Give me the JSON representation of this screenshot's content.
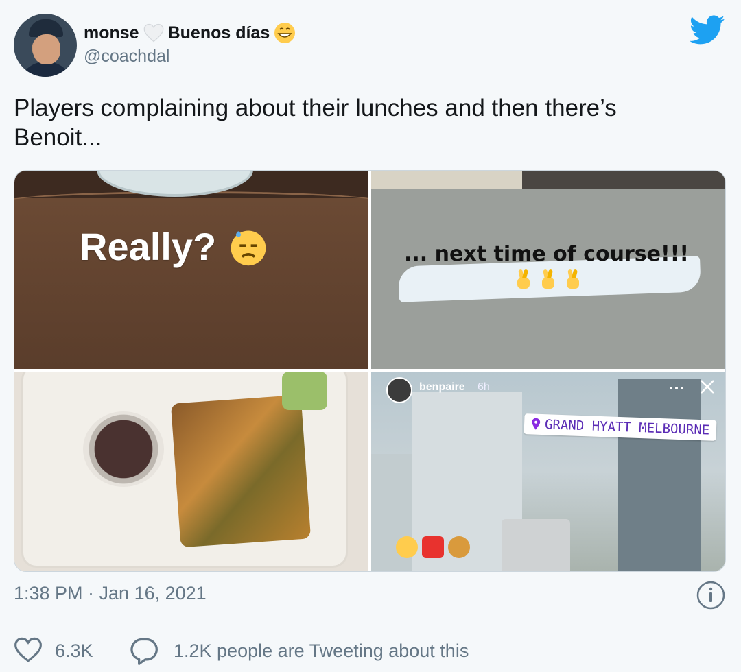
{
  "author": {
    "display_name": "monse",
    "display_name_suffix": "Buenos días",
    "handle": "@coachdal"
  },
  "tweet": {
    "text": "Players complaining about their lunches and then there’s Benoit..."
  },
  "media": {
    "tile1_caption": "Really?",
    "tile2_caption": "... next time of course!!!",
    "tile4_story_user": "benpaire",
    "tile4_story_time": "6h",
    "tile4_location": "GRAND HYATT MELBOURNE"
  },
  "meta": {
    "timestamp": "1:38 PM · Jan 16, 2021"
  },
  "actions": {
    "like_count": "6.3K",
    "reply_text": "1.2K people are Tweeting about this"
  },
  "icons": {
    "heart": "white-heart-icon",
    "grin": "grinning-face-icon",
    "bird": "twitter-bird-icon",
    "info": "info-icon",
    "like": "like-heart-icon",
    "reply": "reply-bubble-icon"
  },
  "colors": {
    "brand": "#1da1f2",
    "secondary_text": "#657786",
    "primary_text": "#14171a",
    "location_text": "#5a2bb5"
  }
}
